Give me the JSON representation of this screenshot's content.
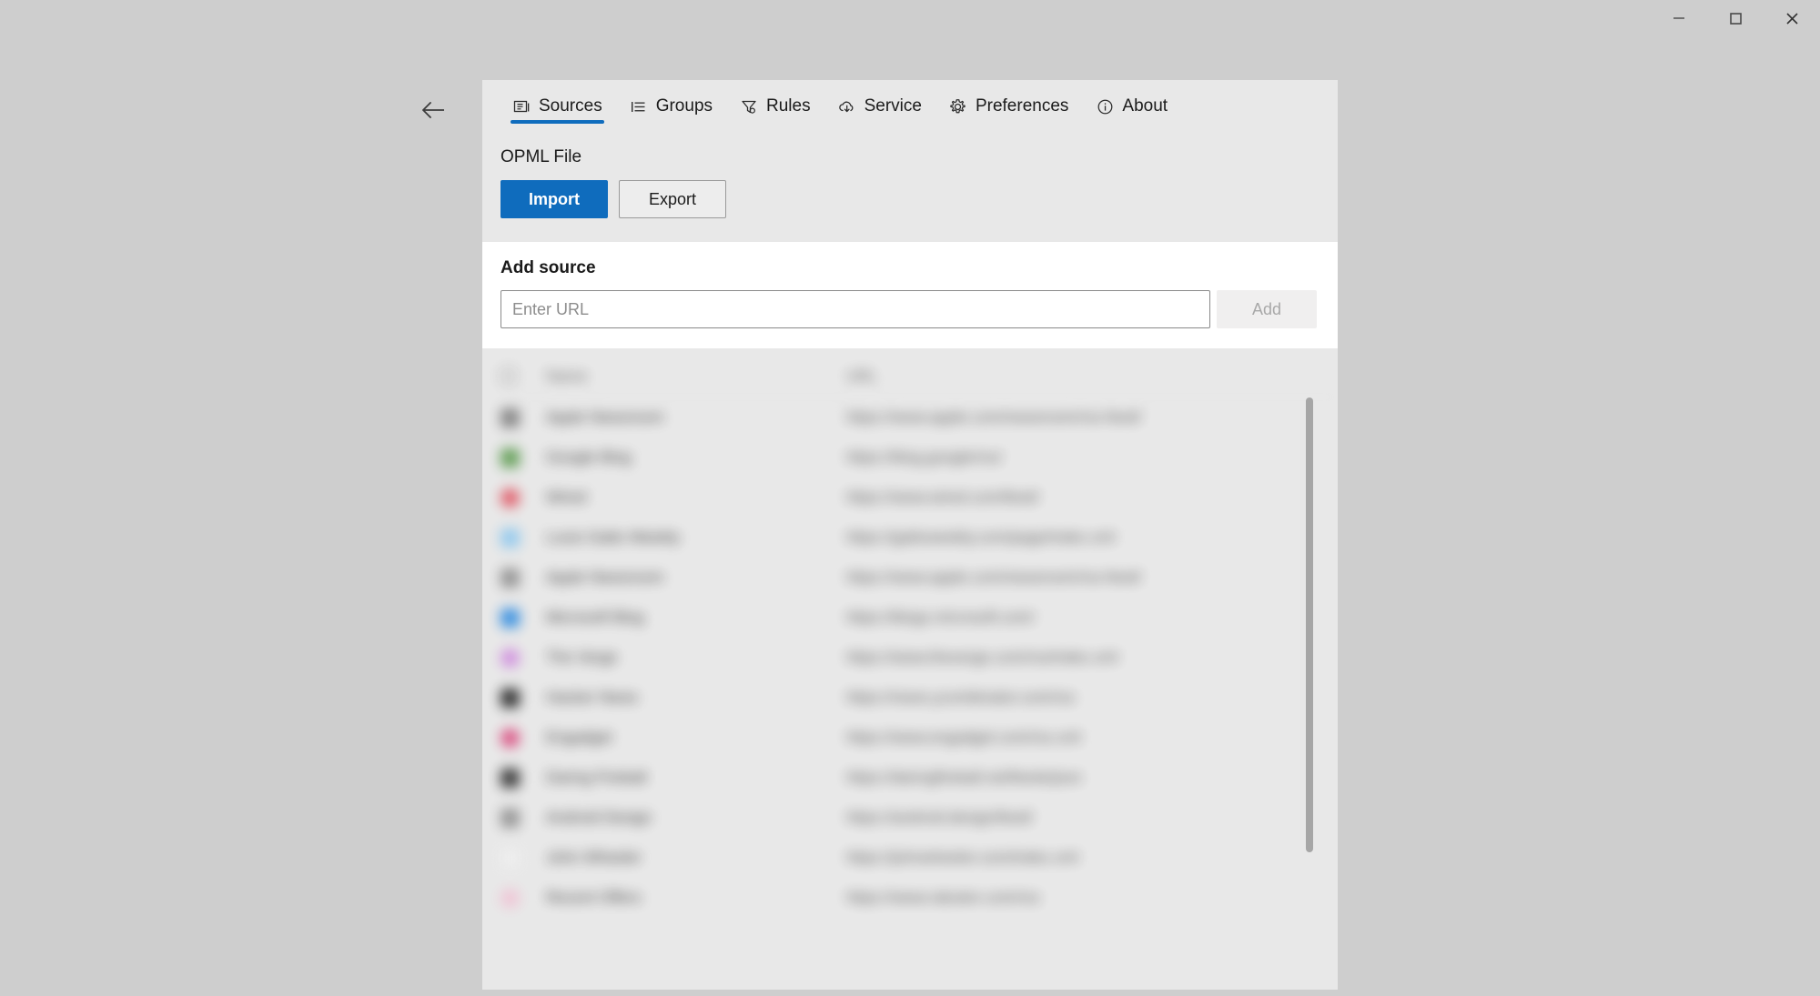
{
  "window": {
    "controls": [
      {
        "name": "minimize",
        "glyph": "minimize-icon"
      },
      {
        "name": "maximize",
        "glyph": "maximize-icon"
      },
      {
        "name": "close",
        "glyph": "close-icon"
      }
    ]
  },
  "navigation": {
    "back_icon": "back-arrow-icon"
  },
  "tabs": [
    {
      "label": "Sources",
      "icon": "sources-icon",
      "active": true
    },
    {
      "label": "Groups",
      "icon": "list-icon",
      "active": false
    },
    {
      "label": "Rules",
      "icon": "filter-icon",
      "active": false
    },
    {
      "label": "Service",
      "icon": "cloud-sync-icon",
      "active": false
    },
    {
      "label": "Preferences",
      "icon": "gear-icon",
      "active": false
    },
    {
      "label": "About",
      "icon": "info-icon",
      "active": false
    }
  ],
  "opml": {
    "title": "OPML File",
    "import_label": "Import",
    "export_label": "Export"
  },
  "add_source": {
    "title": "Add source",
    "placeholder": "Enter URL",
    "value": "",
    "add_label": "Add"
  },
  "source_list": {
    "headers": {
      "name": "Name",
      "url": "URL"
    },
    "rows": [
      {
        "name": "Apple Newsroom",
        "url": "https://www.apple.com/newsroom/rss-feed/",
        "color": "#7d7d7d",
        "shape": "square"
      },
      {
        "name": "Google Blog",
        "url": "https://blog.google/rss/",
        "color": "#5b9a4e",
        "shape": "square"
      },
      {
        "name": "Wired",
        "url": "https://www.wired.com/feed/",
        "color": "#e05260",
        "shape": "round"
      },
      {
        "name": "Louis Gatto Weekly",
        "url": "https://gattoweekly.com/page/index.xml",
        "color": "#8fc8ee",
        "shape": "square"
      },
      {
        "name": "Apple Newsroom",
        "url": "https://www.apple.com/newsroom/rss-feed/",
        "color": "#8d8d8d",
        "shape": "square"
      },
      {
        "name": "Microsoft Blog",
        "url": "https://blogs.microsoft.com/",
        "color": "#2f8be0",
        "shape": "square"
      },
      {
        "name": "The Verge",
        "url": "https://www.theverge.com/rss/index.xml",
        "color": "#cf8ade",
        "shape": "round"
      },
      {
        "name": "Hacker News",
        "url": "https://news.ycombinator.com/rss",
        "color": "#232323",
        "shape": "square"
      },
      {
        "name": "Engadget",
        "url": "https://www.engadget.com/rss.xml",
        "color": "#d9477c",
        "shape": "round"
      },
      {
        "name": "Daring Fireball",
        "url": "https://daringfireball.net/feeds/json",
        "color": "#2e2e2e",
        "shape": "square"
      },
      {
        "name": "Android Design",
        "url": "https://android.design/feed/",
        "color": "#8f8f8f",
        "shape": "square"
      },
      {
        "name": "John Wheeler",
        "url": "https://johnwheeler.com/index.xml",
        "color": "#efefef",
        "shape": "square"
      },
      {
        "name": "Recent Offers",
        "url": "https://www.rakuten.com/rss",
        "color": "#f0c2d4",
        "shape": "round"
      }
    ],
    "scrollbar": {
      "visible": true
    }
  },
  "colors": {
    "accent": "#0f6cbd",
    "panel_bg": "#e8e8e8",
    "desktop_bg": "#cecece",
    "white": "#ffffff"
  }
}
